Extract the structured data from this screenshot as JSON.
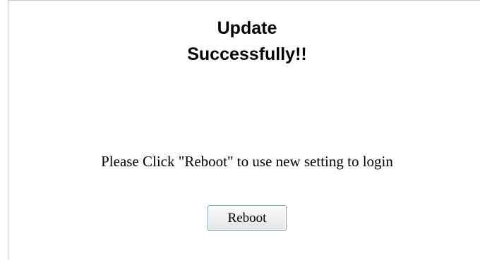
{
  "heading": {
    "line1": "Update",
    "line2": "Successfully!!"
  },
  "message": "Please Click \"Reboot\" to use new setting to login",
  "buttons": {
    "reboot_label": "Reboot"
  }
}
